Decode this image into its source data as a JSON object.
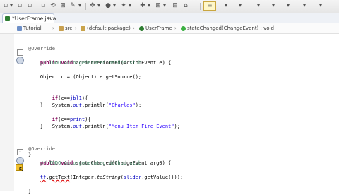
{
  "toolbar": {
    "buttons": [
      "▫",
      "▾",
      "▫",
      "▫",
      "▫",
      "⟲",
      "⊞",
      "✎",
      "▾",
      "✥",
      "▾",
      "●",
      "▾",
      "✦",
      "▾",
      "✚",
      "▾",
      "⊞",
      "▾",
      "⊟",
      "⌂",
      "≡",
      "▾",
      "▾",
      "▾",
      "▾",
      "▾",
      "▾",
      "▾"
    ]
  },
  "tab": {
    "label": "*UserFrame.java",
    "close": "×"
  },
  "breadcrumb": {
    "items": [
      "Tutorial",
      "src",
      "(default package)",
      "UserFrame",
      "stateChanged(ChangeEvent) : void"
    ],
    "separator": "›"
  },
  "code": {
    "lines": [
      "@Override",
      "public void actionPerformed(ActionEvent e) {",
      "    // TODO Auto-generated method stub",
      "",
      "    Object c = (Object) e.getSource();",
      "",
      "    if(c==jbl1){",
      "        System.out.println(\"Charles\");",
      "    }",
      "    if(c==print){",
      "        System.out.println(\"Menu Item Fire Event\");",
      "    }",
      "",
      "",
      "}",
      "",
      "@Override",
      "public void stateChanged(ChangeEvent arg0) {",
      "    // TODO Auto-generated method stub",
      "    tf.getText(Integer.toString(slider.getValue()));",
      "",
      "",
      "}"
    ],
    "colors": {
      "annotation": "#646464",
      "keyword": "#7f0055",
      "comment": "#3f7f5f",
      "string": "#2a00ff",
      "field": "#0000c0"
    }
  }
}
